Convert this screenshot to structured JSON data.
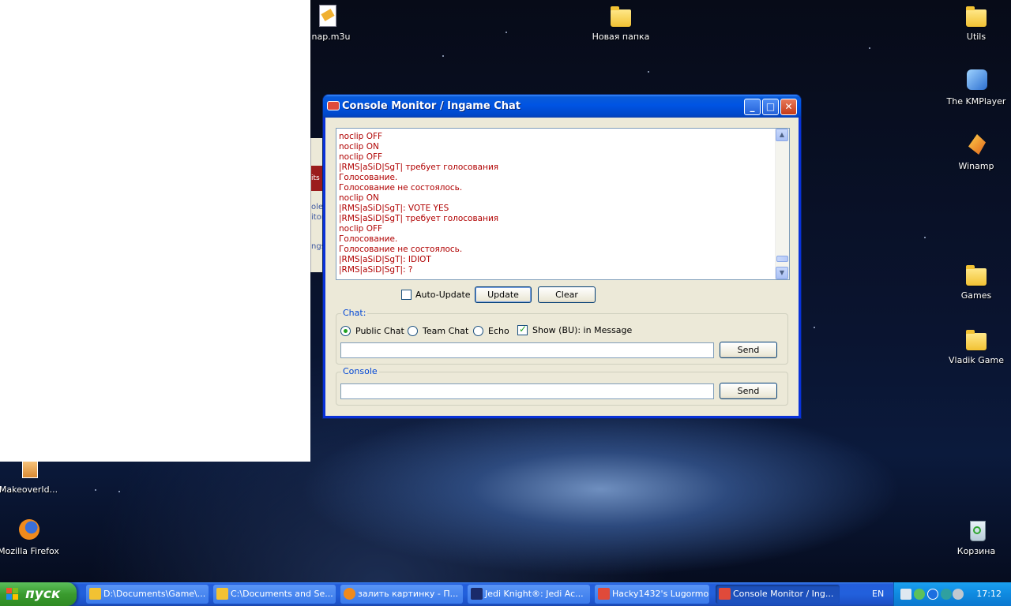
{
  "desktop": {
    "icons": [
      {
        "label": "nap.m3u"
      },
      {
        "label": "Новая папка"
      },
      {
        "label": "Utils"
      },
      {
        "label": "The KMPlayer"
      },
      {
        "label": "Winamp"
      },
      {
        "label": "Games"
      },
      {
        "label": "Vladik Game"
      },
      {
        "label": "MakeoverId..."
      },
      {
        "label": "Mozilla Firefox"
      },
      {
        "label": "Корзина"
      }
    ],
    "partial_window": {
      "red_text": "its",
      "text1": "ole",
      "text2": "itor",
      "text3": "ngs"
    }
  },
  "window": {
    "title": "Console Monitor / Ingame Chat",
    "minimize_glyph": "_",
    "maximize_glyph": "□",
    "close_glyph": "✕",
    "log_lines": [
      "noclip OFF",
      "noclip ON",
      "noclip OFF",
      "|RMS|aSiD|SgT| требует голосования",
      "Голосование.",
      "Голосование не состоялось.",
      "noclip ON",
      "|RMS|aSiD|SgT|: VOTE YES",
      "|RMS|aSiD|SgT| требует голосования",
      "noclip OFF",
      "Голосование.",
      "Голосование не состоялось.",
      "|RMS|aSiD|SgT|: IDIOT",
      "|RMS|aSiD|SgT|: ?"
    ],
    "auto_update_label": "Auto-Update",
    "auto_update_checked": false,
    "update_label": "Update",
    "clear_label": "Clear",
    "chat": {
      "group_title": "Chat:",
      "public_chat_label": "Public Chat",
      "team_chat_label": "Team Chat",
      "echo_label": "Echo",
      "show_bu_label": "Show (BU): in Message",
      "show_bu_checked": true,
      "selected": "Public Chat",
      "input_value": "",
      "send_label": "Send"
    },
    "console": {
      "group_title": "Console",
      "input_value": "",
      "send_label": "Send"
    }
  },
  "taskbar": {
    "start_label": "пуск",
    "items": [
      {
        "label": "D:\\Documents\\Game\\...",
        "icon": "folder-icon"
      },
      {
        "label": "C:\\Documents and Se...",
        "icon": "folder-icon"
      },
      {
        "label": "залить картинку - П...",
        "icon": "firefox-icon"
      },
      {
        "label": "Jedi Knight®: Jedi Ac...",
        "icon": "jedi-knight-icon"
      },
      {
        "label": "Hacky1432's Lugormo...",
        "icon": "app-icon"
      },
      {
        "label": "Console Monitor / Ing...",
        "icon": "app-icon",
        "active": true
      }
    ],
    "language": "EN",
    "clock": "17:12"
  }
}
